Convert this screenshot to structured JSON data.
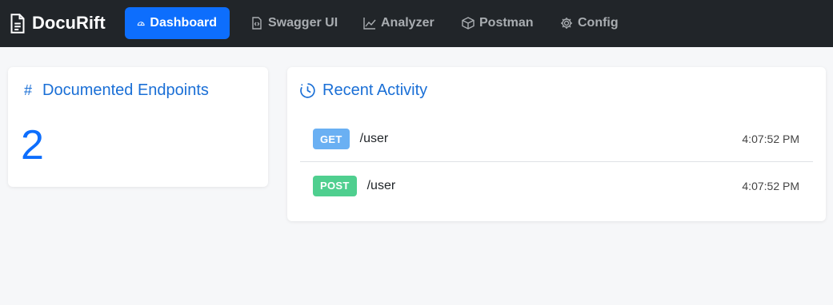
{
  "app": {
    "brand": "DocuRift"
  },
  "nav": {
    "items": [
      {
        "label": "Dashboard",
        "icon": "speedometer-icon",
        "active": true
      },
      {
        "label": "Swagger UI",
        "icon": "code-file-icon",
        "active": false
      },
      {
        "label": "Analyzer",
        "icon": "line-chart-icon",
        "active": false
      },
      {
        "label": "Postman",
        "icon": "box-icon",
        "active": false
      },
      {
        "label": "Config",
        "icon": "gear-icon",
        "active": false
      }
    ]
  },
  "endpoints": {
    "title": "Documented Endpoints",
    "hash": "#",
    "count": "2"
  },
  "activity": {
    "title": "Recent Activity",
    "items": [
      {
        "method": "GET",
        "path": "/user",
        "time": "4:07:52 PM",
        "color": "#6ab0f3"
      },
      {
        "method": "POST",
        "path": "/user",
        "time": "4:07:52 PM",
        "color": "#4fcf8f"
      }
    ]
  },
  "colors": {
    "accent": "#0d6efd",
    "navbar": "#212529",
    "background": "#f6f7f9"
  }
}
